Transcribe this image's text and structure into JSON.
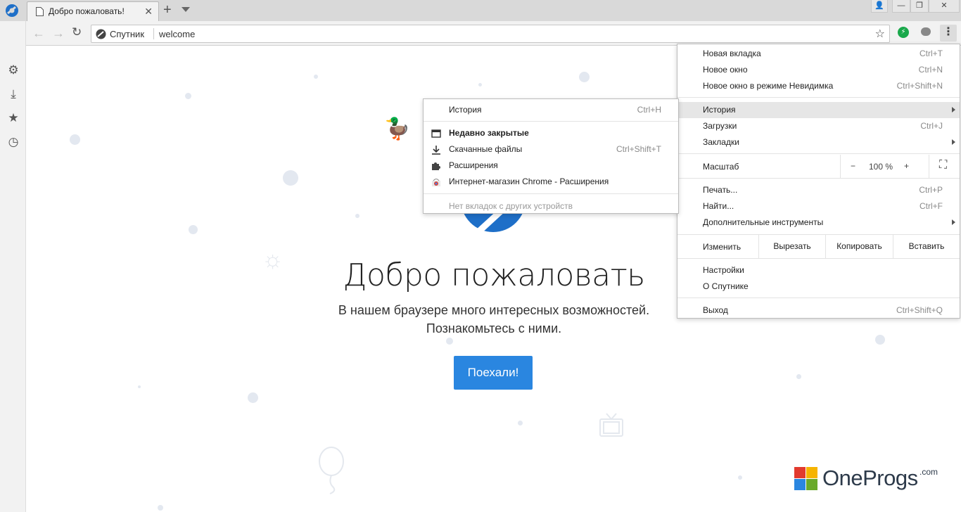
{
  "tab": {
    "title": "Добро пожаловать!",
    "close": "✕"
  },
  "toolbar": {
    "back": "←",
    "forward": "→",
    "reload": "↻",
    "site_name": "Спутник",
    "url": "welcome",
    "star": "☆",
    "menu_dots": "⋮"
  },
  "window_controls": {
    "profile": "👤",
    "minimize": "—",
    "restore": "❐",
    "close": "✕"
  },
  "sidebar": {
    "icons": [
      "pin-icon",
      "gear-icon",
      "download-icon",
      "star-icon",
      "history-icon"
    ]
  },
  "page": {
    "title": "Добро пожаловать",
    "subtitle_line1": "В нашем браузере много интересных возможностей.",
    "subtitle_line2": "Познакомьтесь с ними.",
    "button": "Поехали!"
  },
  "main_menu": {
    "new_tab": "Новая вкладка",
    "new_tab_sc": "Ctrl+T",
    "new_window": "Новое окно",
    "new_window_sc": "Ctrl+N",
    "incognito": "Новое окно в режиме Невидимка",
    "incognito_sc": "Ctrl+Shift+N",
    "history": "История",
    "downloads": "Загрузки",
    "downloads_sc": "Ctrl+J",
    "bookmarks": "Закладки",
    "zoom": "Масштаб",
    "zoom_minus": "−",
    "zoom_value": "100 %",
    "zoom_plus": "+",
    "fullscreen": "⛶",
    "print": "Печать...",
    "print_sc": "Ctrl+P",
    "find": "Найти...",
    "find_sc": "Ctrl+F",
    "more_tools": "Дополнительные инструменты",
    "edit": "Изменить",
    "cut": "Вырезать",
    "copy": "Копировать",
    "paste": "Вставить",
    "settings": "Настройки",
    "about": "О Спутнике",
    "exit": "Выход",
    "exit_sc": "Ctrl+Shift+Q"
  },
  "history_menu": {
    "history": "История",
    "history_sc": "Ctrl+H",
    "recently_closed": "Недавно закрытые",
    "downloaded_files": "Скачанные файлы",
    "downloaded_files_sc": "Ctrl+Shift+T",
    "extensions": "Расширения",
    "webstore": "Интернет-магазин Chrome - Расширения",
    "no_tabs": "Нет вкладок с других устройств"
  },
  "watermark": {
    "text": "OneProgs",
    "suffix": ".com"
  },
  "colors": {
    "accent": "#2a86e0",
    "logo_blue": "#1e6fc8",
    "menu_highlight": "#e6e6e6"
  }
}
